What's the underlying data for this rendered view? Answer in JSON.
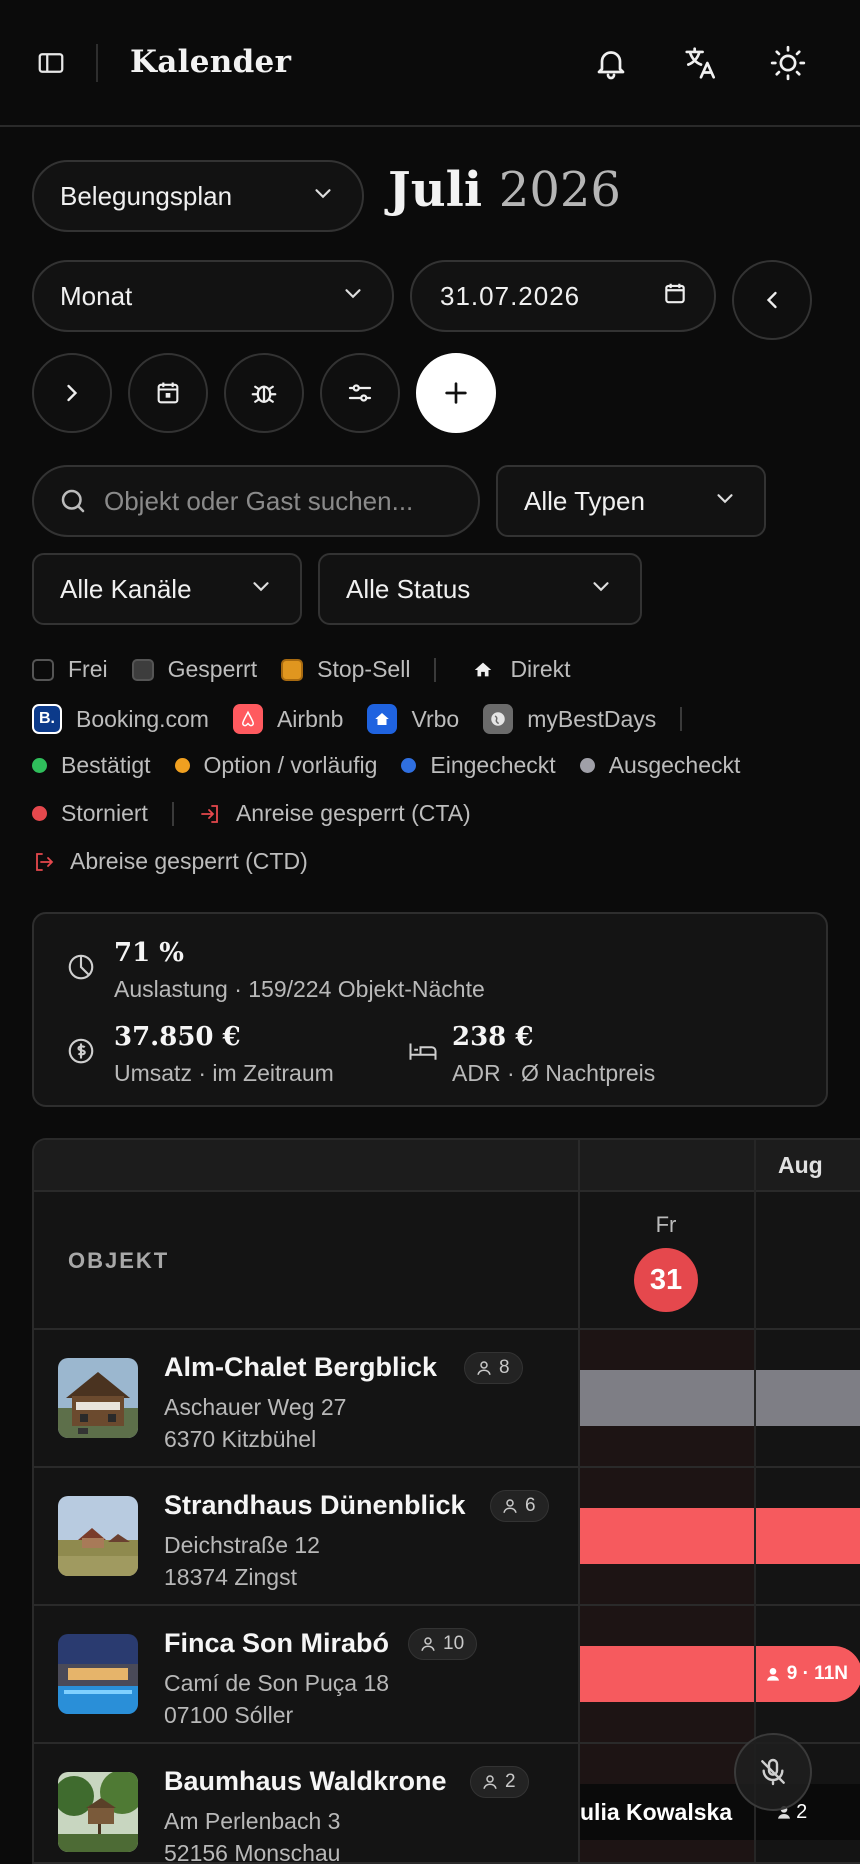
{
  "header": {
    "title": "Kalender"
  },
  "view_select": "Belegungsplan",
  "month_title": {
    "month": "Juli",
    "year": "2026"
  },
  "period_select": "Monat",
  "date_input": "31.07.2026",
  "filters": {
    "search_placeholder": "Objekt oder Gast suchen...",
    "type": "Alle Typen",
    "channel": "Alle Kanäle",
    "status": "Alle Status"
  },
  "legend": {
    "free": "Frei",
    "blocked": "Gesperrt",
    "stopsell": "Stop-Sell",
    "direct": "Direkt",
    "booking": "Booking.com",
    "airbnb": "Airbnb",
    "vrbo": "Vrbo",
    "mybestdays": "myBestDays",
    "confirmed": "Bestätigt",
    "option": "Option / vorläufig",
    "checkedin": "Eingecheckt",
    "checkedout": "Ausgecheckt",
    "cancelled": "Storniert",
    "cta": "Anreise gesperrt (CTA)",
    "ctd": "Abreise gesperrt (CTD)",
    "colors": {
      "free": "#0b0b0b",
      "blocked": "#3d3d3d",
      "stopsell": "#e0961f",
      "confirmed": "#2fbe5b",
      "option": "#f0a020",
      "checkedin": "#2f6fe0",
      "checkedout": "#a0a0a8",
      "cancelled": "#e5484d"
    }
  },
  "stats": {
    "occupancy_value": "71 %",
    "occupancy_label": "Auslastung · 159/224 Objekt-Nächte",
    "revenue_value": "37.850 €",
    "revenue_label": "Umsatz · im Zeitraum",
    "adr_value": "238 €",
    "adr_label": "ADR · Ø Nachtpreis"
  },
  "table": {
    "object_header": "OBJEKT",
    "next_month": "Aug",
    "day": {
      "name": "Fr",
      "number": "31"
    },
    "rows": [
      {
        "name": "Alm-Chalet Bergblick",
        "guests": "8",
        "street": "Aschauer Weg 27",
        "city": "6370 Kitzbühel",
        "bar_color": "#7e7e85"
      },
      {
        "name": "Strandhaus Dünenblick",
        "guests": "6",
        "street": "Deichstraße 12",
        "city": "18374 Zingst",
        "bar_color": "#f65a5e"
      },
      {
        "name": "Finca Son Mirabó",
        "guests": "10",
        "street": "Camí de Son Puça 18",
        "city": "07100 Sóller",
        "bar_color": "#f65a5e",
        "bar_text": "9 · 11N"
      },
      {
        "name": "Baumhaus Waldkrone",
        "guests": "2",
        "street": "Am Perlenbach 3",
        "city": "52156 Monschau",
        "bar_text": "ulia Kowalska",
        "bar_guests": "2"
      }
    ]
  }
}
